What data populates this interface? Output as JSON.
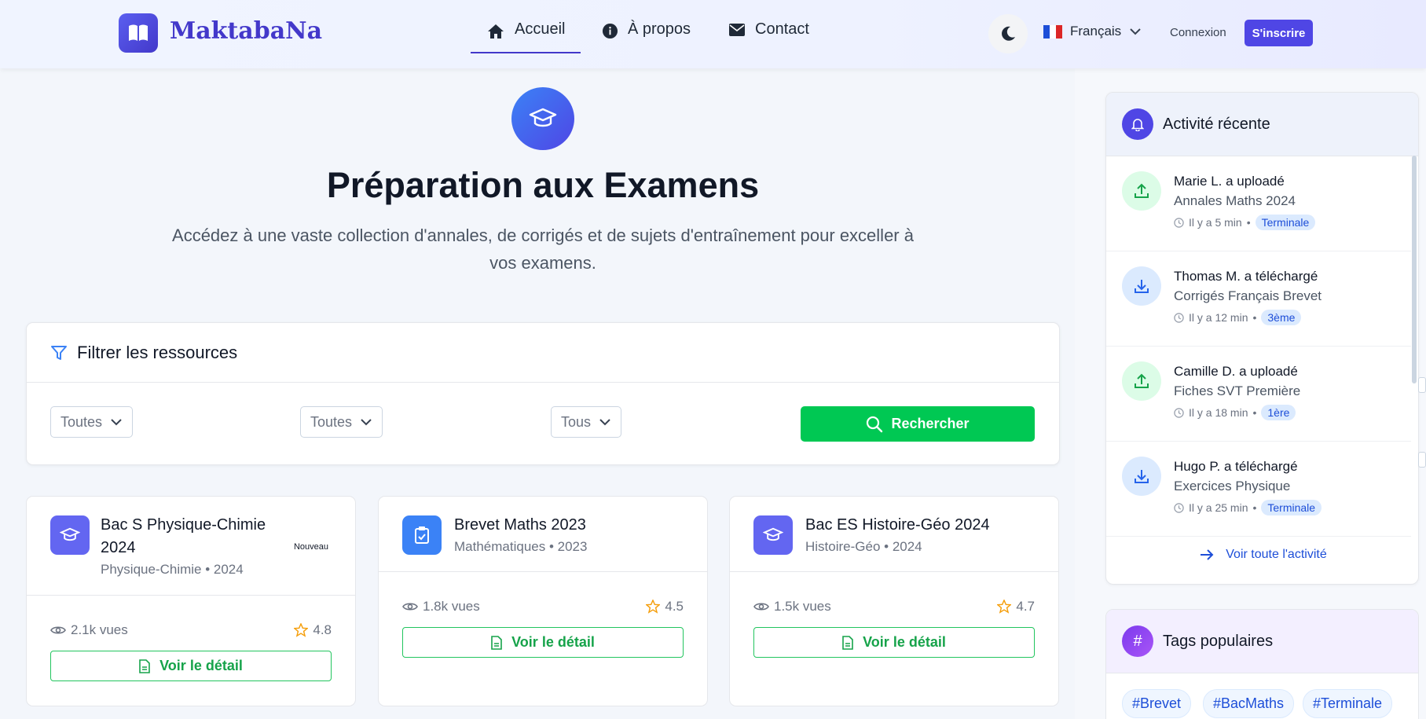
{
  "header": {
    "brand": "MaktabaNa",
    "nav": [
      {
        "label": "Accueil",
        "icon": "home-icon"
      },
      {
        "label": "À propos",
        "icon": "info-icon"
      },
      {
        "label": "Contact",
        "icon": "mail-icon"
      }
    ],
    "language": "Français",
    "login": "Connexion",
    "signup": "S'inscrire"
  },
  "hero": {
    "title": "Préparation aux Examens",
    "subtitle": "Accédez à une vaste collection d'annales, de corrigés et de sujets d'entraînement pour exceller à vos examens."
  },
  "filter": {
    "title": "Filtrer les ressources",
    "selects": [
      "Toutes",
      "Toutes",
      "Tous"
    ],
    "search_label": "Rechercher"
  },
  "resources": [
    {
      "title": "Bac S Physique-Chimie 2024",
      "meta": "Physique-Chimie • 2024",
      "badge": "Nouveau",
      "views": "2.1k vues",
      "rating": "4.8",
      "button": "Voir le détail",
      "icon": "graduation-cap-icon",
      "color": "#6366f1"
    },
    {
      "title": "Brevet Maths 2023",
      "meta": "Mathématiques • 2023",
      "views": "1.8k vues",
      "rating": "4.5",
      "button": "Voir le détail",
      "icon": "clipboard-check-icon",
      "color": "#3b82f6"
    },
    {
      "title": "Bac ES Histoire-Géo 2024",
      "meta": "Histoire-Géo • 2024",
      "views": "1.5k vues",
      "rating": "4.7",
      "button": "Voir le détail",
      "icon": "graduation-cap-icon",
      "color": "#6366f1"
    }
  ],
  "activity": {
    "title": "Activité récente",
    "items": [
      {
        "title": "Marie L. a uploadé",
        "subtitle": "Annales Maths 2024",
        "time": "Il y a 5 min",
        "level": "Terminale",
        "type": "upload"
      },
      {
        "title": "Thomas M. a téléchargé",
        "subtitle": "Corrigés Français Brevet",
        "time": "Il y a 12 min",
        "level": "3ème",
        "type": "download"
      },
      {
        "title": "Camille D. a uploadé",
        "subtitle": "Fiches SVT Première",
        "time": "Il y a 18 min",
        "level": "1ère",
        "type": "upload"
      },
      {
        "title": "Hugo P. a téléchargé",
        "subtitle": "Exercices Physique",
        "time": "Il y a 25 min",
        "level": "Terminale",
        "type": "download"
      }
    ],
    "see_all": "Voir toute l'activité"
  },
  "tags": {
    "title": "Tags populaires",
    "items": [
      "#Brevet",
      "#BacMaths",
      "#Terminale"
    ]
  },
  "colors": {
    "accent": "#4f46e5",
    "green": "#00c853",
    "upload_bg": "#dcfce7",
    "download_bg": "#dbeafe"
  }
}
